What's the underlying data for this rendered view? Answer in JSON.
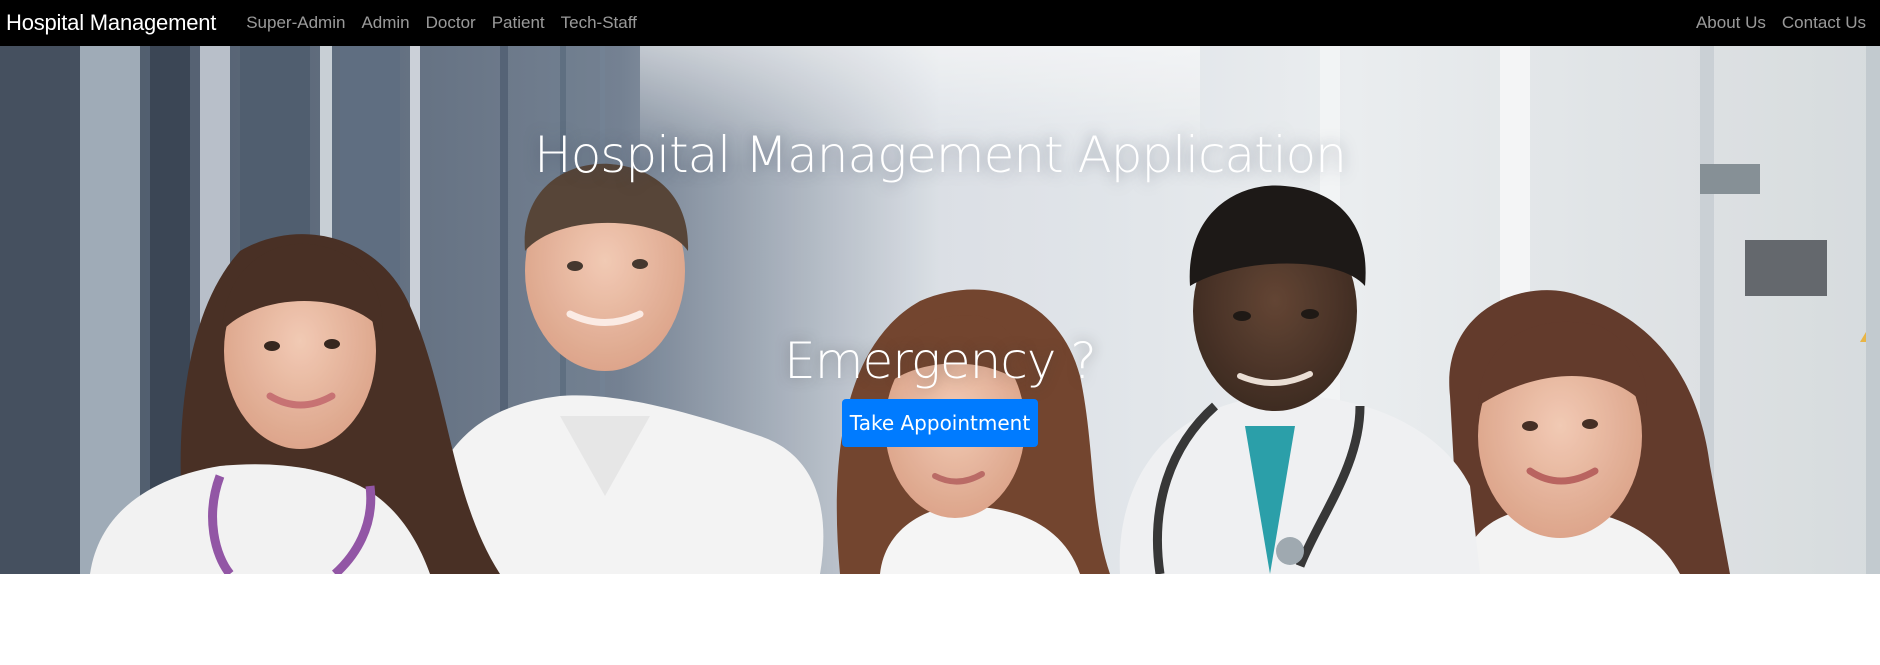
{
  "navbar": {
    "brand": "Hospital Management",
    "left_links": [
      {
        "label": "Super-Admin"
      },
      {
        "label": "Admin"
      },
      {
        "label": "Doctor"
      },
      {
        "label": "Patient"
      },
      {
        "label": "Tech-Staff"
      }
    ],
    "right_links": [
      {
        "label": "About Us"
      },
      {
        "label": "Contact Us"
      }
    ]
  },
  "hero": {
    "title": "Hospital Management Application",
    "subtitle": "Emergency ?",
    "button_label": "Take Appointment"
  },
  "colors": {
    "navbar_bg": "#000000",
    "button_bg": "#007bff",
    "text_light": "#ffffff"
  }
}
